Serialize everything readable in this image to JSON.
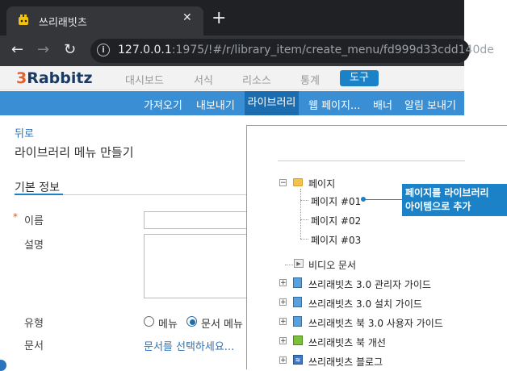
{
  "browser": {
    "tab_title": "쓰리래빗츠",
    "tab_close": "✕",
    "new_tab": "+",
    "url_host": "127.0.0.1",
    "url_rest": ":1975/!#/r/library_item/create_menu/fd999d33cdd140de"
  },
  "app": {
    "logo_3": "3",
    "logo_rest": "Rabbitz",
    "top_nav": [
      "대시보드",
      "서식",
      "리소스",
      "통계",
      "도구"
    ],
    "sub_nav": [
      "가져오기",
      "내보내기",
      "라이브러리",
      "웹 페이지...",
      "배너",
      "알림 보내기"
    ]
  },
  "page": {
    "back": "뒤로",
    "title": "라이브러리 메뉴 만들기",
    "section": "기본 정보",
    "fields": {
      "name": "이름",
      "description": "설명",
      "type": "유형",
      "document": "문서"
    },
    "type_options": [
      "메뉴",
      "문서 메뉴"
    ],
    "document_link": "문서를 선택하세요..."
  },
  "tree": {
    "folder": "페이지",
    "children": [
      "페이지 #01",
      "페이지 #02",
      "페이지 #03"
    ],
    "video": "비디오 문서",
    "books": [
      "쓰리래빗츠 3.0 관리자 가이드",
      "쓰리래빗츠 3.0 설치 가이드",
      "쓰리래빗츠 북 3.0 사용자 가이드",
      "쓰리래빗츠 북 개선",
      "쓰리래빗츠 블로그"
    ]
  },
  "callout": {
    "line1": "페이지를 라이브러리",
    "line2": "아이템으로 추가"
  },
  "colors": {
    "accent": "#1b82c8",
    "subnav": "#3a8ed4",
    "chrome_dark": "#202124"
  }
}
